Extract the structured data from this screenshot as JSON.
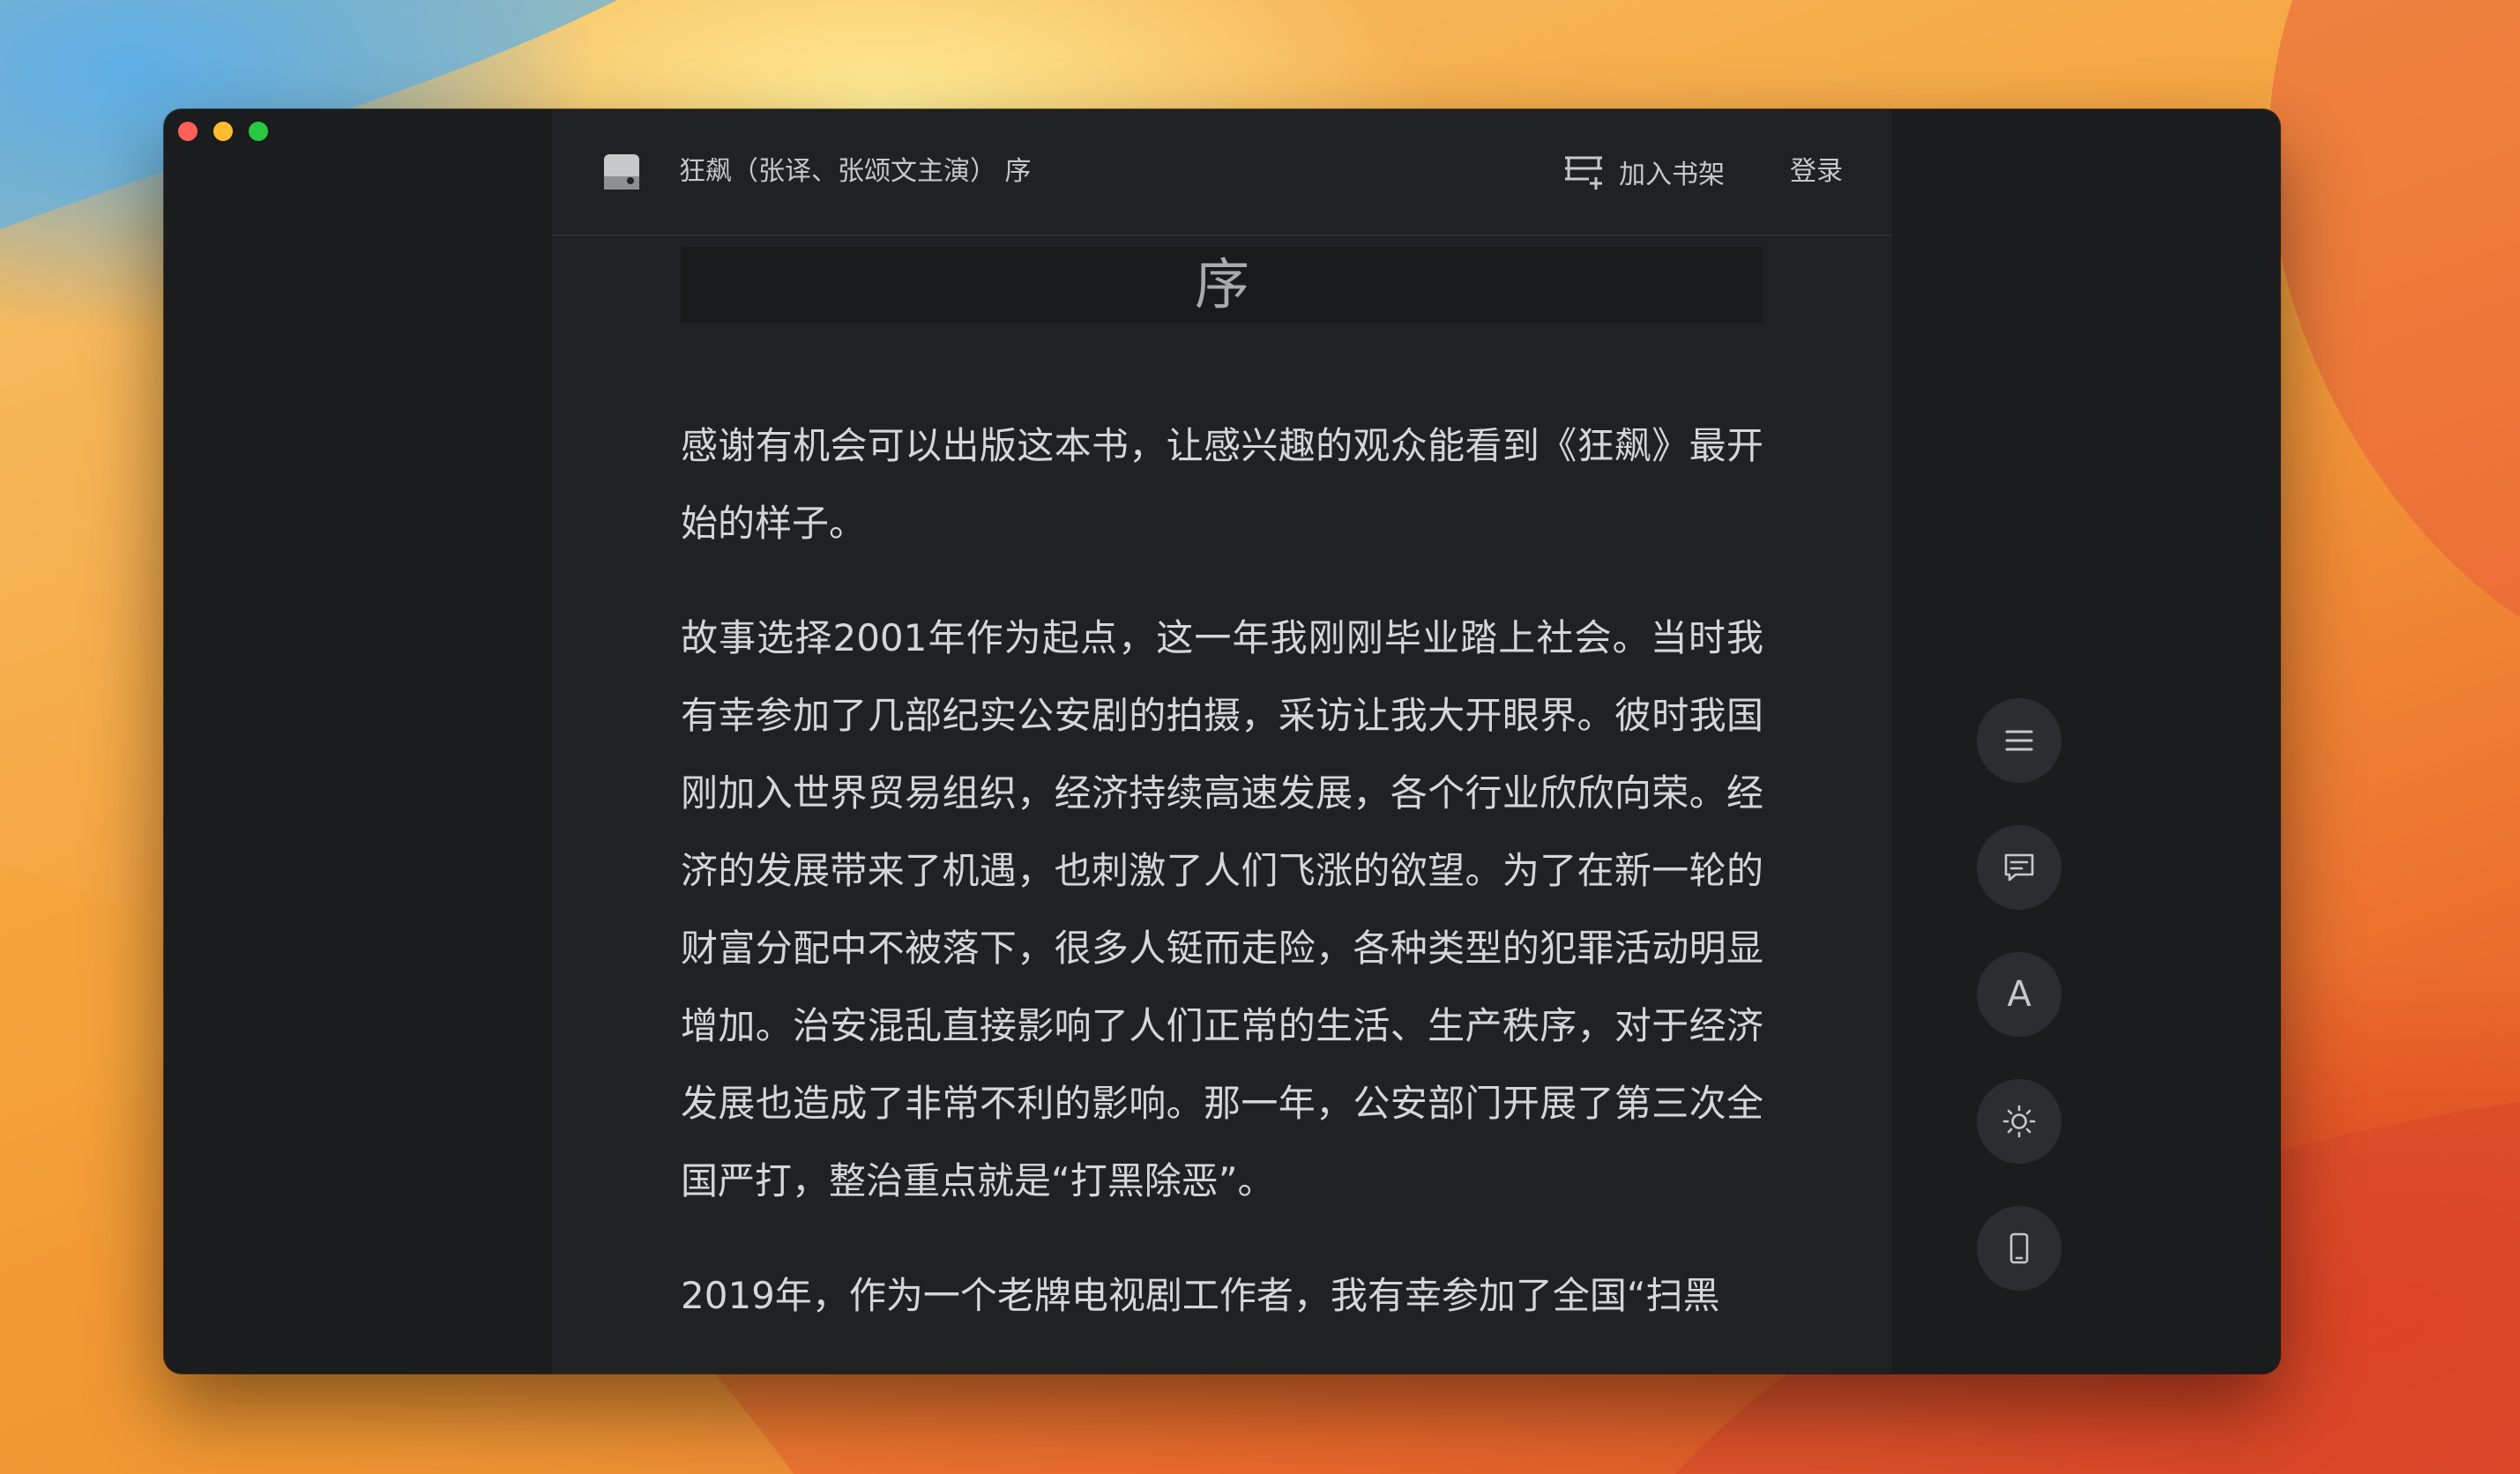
{
  "window": {
    "controls": [
      "close",
      "minimize",
      "maximize"
    ]
  },
  "header": {
    "book_icon": "book-cover-icon",
    "title": "狂飙（张译、张颂文主演） 序",
    "add_to_shelf": "加入书架",
    "login": "登录"
  },
  "chapter": {
    "title": "序",
    "paragraphs": [
      "感谢有机会可以出版这本书，让感兴趣的观众能看到《狂飙》最开始的样子。",
      "故事选择2001年作为起点，这一年我刚刚毕业踏上社会。当时我有幸参加了几部纪实公安剧的拍摄，采访让我大开眼界。彼时我国刚加入世界贸易组织，经济持续高速发展，各个行业欣欣向荣。经济的发展带来了机遇，也刺激了人们飞涨的欲望。为了在新一轮的财富分配中不被落下，很多人铤而走险，各种类型的犯罪活动明显增加。治安混乱直接影响了人们正常的生活、生产秩序，对于经济发展也造成了非常不利的影响。那一年，公安部门开展了第三次全国严打，整治重点就是“打黑除恶”。",
      "2019年，作为一个老牌电视剧工作者，我有幸参加了全国“扫黑"
    ]
  },
  "side_tools": [
    {
      "name": "toc-button",
      "icon": "list-icon"
    },
    {
      "name": "comments-button",
      "icon": "comment-icon"
    },
    {
      "name": "font-button",
      "icon": "font-icon",
      "label": "A"
    },
    {
      "name": "brightness-button",
      "icon": "sun-icon"
    },
    {
      "name": "device-button",
      "icon": "phone-icon"
    }
  ]
}
